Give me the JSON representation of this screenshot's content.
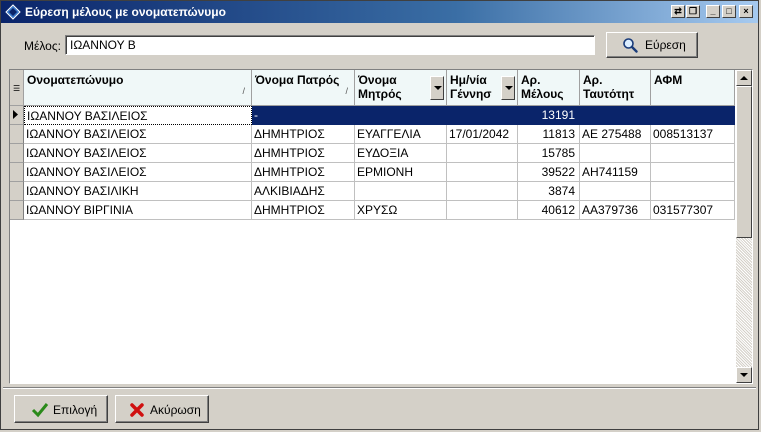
{
  "window": {
    "title": "Εύρεση μέλους με ονοματεπώνυμο",
    "controls": {
      "restore": "⇄",
      "restore2": "❐",
      "minimize": "_",
      "maximize": "□",
      "close": "×"
    }
  },
  "search": {
    "label": "Μέλος:",
    "value": "ΙΩΑΝΝΟΥ Β",
    "button_label": "Εύρεση"
  },
  "table": {
    "columns": [
      {
        "key": "name",
        "label": "Ονοματεπώνυμο",
        "sort": true,
        "drop": false
      },
      {
        "key": "father",
        "label": "Όνομα Πατρός",
        "sort": true,
        "drop": false
      },
      {
        "key": "mother",
        "label": "Όνομα Μητρός",
        "sort": false,
        "drop": true
      },
      {
        "key": "dob",
        "label": "Ημ/νία Γέννησ",
        "sort": false,
        "drop": true
      },
      {
        "key": "member_no",
        "label": "Αρ. Μέλους",
        "sort": false,
        "drop": false
      },
      {
        "key": "id_no",
        "label": "Αρ. Ταυτότητ",
        "sort": false,
        "drop": false
      },
      {
        "key": "afm",
        "label": "ΑΦΜ",
        "sort": false,
        "drop": false
      }
    ],
    "rows": [
      {
        "name": "ΙΩΑΝΝΟΥ ΒΑΣΙΛΕΙΟΣ",
        "father": "-",
        "mother": "",
        "dob": "",
        "member_no": "13191",
        "id_no": "",
        "afm": ""
      },
      {
        "name": "ΙΩΑΝΝΟΥ ΒΑΣΙΛΕΙΟΣ",
        "father": "ΔΗΜΗΤΡΙΟΣ",
        "mother": "ΕΥΑΓΓΕΛΙΑ",
        "dob": "17/01/2042",
        "member_no": "11813",
        "id_no": "ΑΕ 275488",
        "afm": "008513137"
      },
      {
        "name": "ΙΩΑΝΝΟΥ ΒΑΣΙΛΕΙΟΣ",
        "father": "ΔΗΜΗΤΡΙΟΣ",
        "mother": "ΕΥΔΟΞΙΑ",
        "dob": "",
        "member_no": "15785",
        "id_no": "",
        "afm": ""
      },
      {
        "name": "ΙΩΑΝΝΟΥ ΒΑΣΙΛΕΙΟΣ",
        "father": "ΔΗΜΗΤΡΙΟΣ",
        "mother": "ΕΡΜΙΟΝΗ",
        "dob": "",
        "member_no": "39522",
        "id_no": "ΑΗ741159",
        "afm": ""
      },
      {
        "name": "ΙΩΑΝΝΟΥ ΒΑΣΙΛΙΚΗ",
        "father": "ΑΛΚΙΒΙΑΔΗΣ",
        "mother": "",
        "dob": "",
        "member_no": "3874",
        "id_no": "",
        "afm": ""
      },
      {
        "name": "ΙΩΑΝΝΟΥ ΒΙΡΓΙΝΙΑ",
        "father": "ΔΗΜΗΤΡΙΟΣ",
        "mother": "ΧΡΥΣΩ",
        "dob": "",
        "member_no": "40612",
        "id_no": "ΑΑ379736",
        "afm": "031577307"
      }
    ]
  },
  "footer": {
    "select_label": "Επιλογή",
    "cancel_label": "Ακύρωση"
  },
  "colors": {
    "title_start": "#0a246a",
    "title_end": "#a6caf0",
    "selection": "#0a246a",
    "face": "#d4d0c8"
  }
}
